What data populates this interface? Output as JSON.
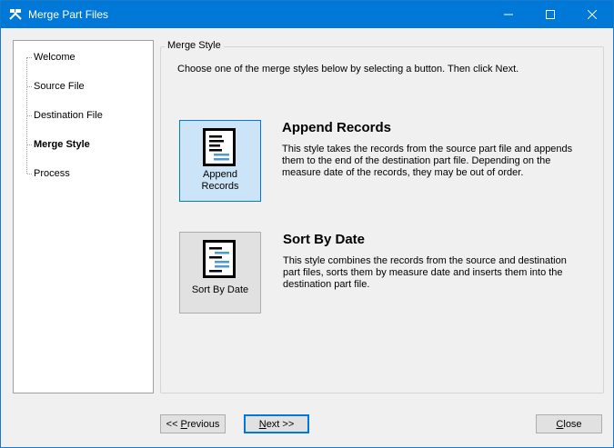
{
  "window": {
    "title": "Merge Part Files",
    "controls": {
      "minimize": "─",
      "maximize": "☐",
      "close": "✕"
    }
  },
  "nav": {
    "items": [
      {
        "label": "Welcome",
        "active": false
      },
      {
        "label": "Source File",
        "active": false
      },
      {
        "label": "Destination File",
        "active": false
      },
      {
        "label": "Merge Style",
        "active": true
      },
      {
        "label": "Process",
        "active": false
      }
    ]
  },
  "group": {
    "title": "Merge Style",
    "instructions": "Choose one of the merge styles below by selecting a button. Then click Next."
  },
  "options": {
    "append": {
      "button_line1": "Append",
      "button_line2": "Records",
      "title": "Append Records",
      "description": "This style takes the records from the source part file and appends them to the end of the destination part file. Depending on the measure date of the records, they may be out of order.",
      "selected": true
    },
    "sort": {
      "button_label": "Sort By Date",
      "title": "Sort By Date",
      "description": "This style combines the records from the source and destination part files, sorts them by measure date and inserts them into the destination part file.",
      "selected": false
    }
  },
  "buttons": {
    "previous_prefix": "<< ",
    "previous_mnemonic": "P",
    "previous_rest": "revious",
    "next_mnemonic": "N",
    "next_rest": "ext >>",
    "close_mnemonic": "C",
    "close_rest": "lose"
  },
  "colors": {
    "titlebar": "#0078d7",
    "selected_button": "#cce4f7",
    "icon_accent": "#4a9ad4"
  }
}
